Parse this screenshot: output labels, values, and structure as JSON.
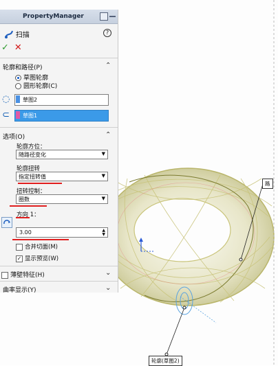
{
  "property_manager": {
    "title": "PropertyManager",
    "feature_name": "扫描"
  },
  "sections": {
    "profile_path": {
      "title": "轮廓和路径(P)",
      "radio_sketch": "草图轮廓",
      "radio_circle": "圆形轮廓(C)",
      "profile_value": "草图2",
      "path_value": "草图1"
    },
    "options": {
      "title": "选项(O)",
      "orientation_label": "轮廓方位：",
      "orientation_value": "随路径变化",
      "twist_label": "轮廓扭转",
      "twist_value": "指定扭转值",
      "twist_control_label": "扭转控制：",
      "twist_control_value": "圈数",
      "direction_label": "方向 1：",
      "direction_value": "3.00",
      "merge_tangent": "合并切面(M)",
      "show_preview": "显示预览(W)"
    },
    "thin_feature": {
      "title": "薄壁特征(H)"
    },
    "curvature": {
      "title": "曲率显示(Y)"
    }
  },
  "viewport": {
    "path_callout": "路",
    "profile_callout": "轮廓(草图2)"
  },
  "colors": {
    "selection_blue": "#3b9ae8",
    "ok_green": "#2e9a2e",
    "cancel_red": "#d21a1a",
    "annotation_red": "#e01e1e",
    "profile_chip": "#4a90e2",
    "path_chip": "#e05aa5"
  }
}
